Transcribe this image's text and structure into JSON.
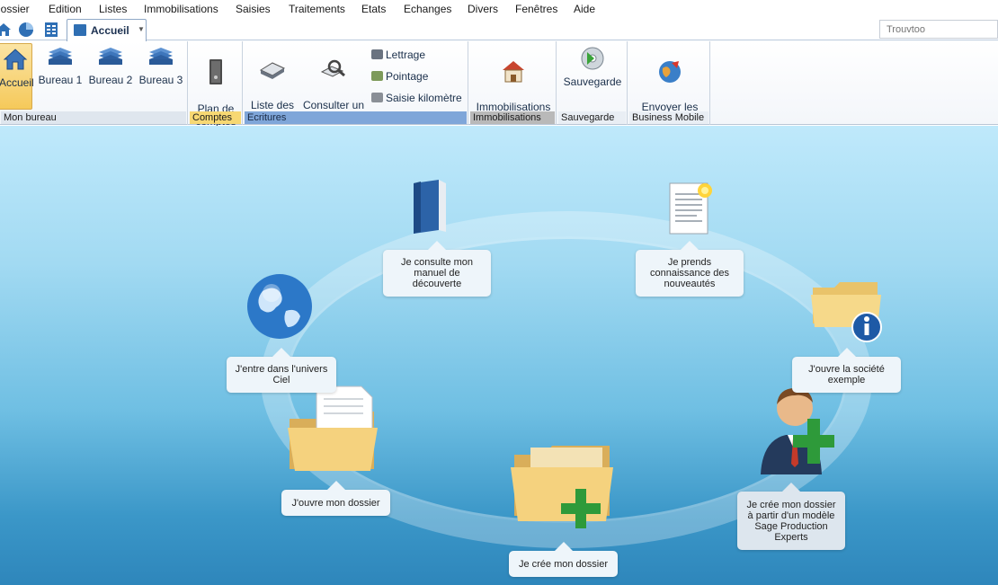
{
  "menu": {
    "items": [
      "Dossier",
      "Edition",
      "Listes",
      "Immobilisations",
      "Saisies",
      "Traitements",
      "Etats",
      "Echanges",
      "Divers",
      "Fenêtres",
      "Aide"
    ]
  },
  "toolbar": {
    "tab_label": "Accueil",
    "search_placeholder": "Trouvtoo"
  },
  "ribbon": {
    "groups": [
      {
        "footer": "Mon bureau",
        "buttons": [
          "Accueil",
          "Bureau 1",
          "Bureau 2",
          "Bureau 3"
        ]
      },
      {
        "footer": "Comptes",
        "buttons": [
          "Plan de\ncomptes"
        ]
      },
      {
        "footer": "Ecritures",
        "buttons": [
          "Liste des\nécritures",
          "Consulter un\ncompte"
        ],
        "small_buttons": [
          "Lettrage",
          "Pointage",
          "Saisie kilomètre"
        ]
      },
      {
        "footer": "Immobilisations",
        "buttons": [
          "Immobilisations\net crédits-bails"
        ]
      },
      {
        "footer": "Sauvegarde",
        "buttons": [
          "Sauvegarde"
        ]
      },
      {
        "footer": "Business Mobile",
        "buttons": [
          "Envoyer les\ndonnées"
        ]
      }
    ],
    "footer_colors": {
      "mon_bureau": "#dfe6ee",
      "comptes": "#f7d873",
      "ecritures": "#7fa6d9",
      "immobilisations": "#b9b9b9",
      "default": "#e9eef4"
    }
  },
  "main": {
    "steps": [
      {
        "id": "manuel",
        "label": "Je consulte mon\nmanuel de\ndécouverte",
        "icon": "book-icon"
      },
      {
        "id": "nouveautes",
        "label": "Je prends\nconnaissance des\nnouveautés",
        "icon": "document-icon"
      },
      {
        "id": "univers",
        "label": "J'entre dans l'univers\nCiel",
        "icon": "globe-icon"
      },
      {
        "id": "societe",
        "label": "J'ouvre la société\nexemple",
        "icon": "info-folder-icon"
      },
      {
        "id": "ouvre",
        "label": "J'ouvre mon dossier",
        "icon": "open-folder-icon"
      },
      {
        "id": "modele",
        "label": "Je crée mon dossier\nà partir d'un modèle\nSage Production\nExperts",
        "icon": "user-add-icon"
      },
      {
        "id": "cree",
        "label": "Je crée mon dossier",
        "icon": "add-folder-icon"
      }
    ]
  }
}
